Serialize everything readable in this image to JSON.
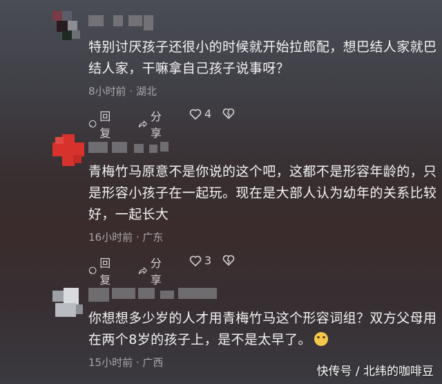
{
  "comments": [
    {
      "text": "特别讨厌孩子还很小的时候就开始拉郎配，想巴结人家就巴结人家，干嘛拿自己孩子说事呀？",
      "meta": "8小时前 · 湖北",
      "reply_label": "回复",
      "share_label": "分享",
      "like_count": "4"
    },
    {
      "text": "青梅竹马原意不是你说的这个吧，这都不是形容年龄的，只是形容小孩子在一起玩。现在是大部人认为幼年的关系比较好，一起长大",
      "meta": "16小时前 · 广东",
      "reply_label": "回复",
      "share_label": "分享",
      "like_count": "3"
    },
    {
      "text": "你想想多少岁的人才用青梅竹马这个形容词组？双方父母用在两个8岁的孩子上，是不是太早了。",
      "meta": "15小时前 · 广西"
    }
  ],
  "watermark": "快传号 / 北纬的咖啡豆",
  "icons": [
    "reply-icon",
    "share-icon",
    "like-icon",
    "dislike-icon",
    "grimace-emoji-icon"
  ],
  "colors": {
    "avatar2_accent": "#d8322d"
  }
}
